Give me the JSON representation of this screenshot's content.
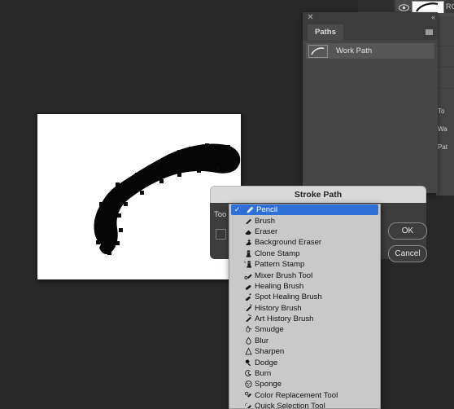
{
  "app": {
    "background_color": "#282828"
  },
  "channels_strip": {
    "eye_icon": "eye-icon",
    "thumbnail_icon": "path-thumbnail-icon",
    "label": "RGB"
  },
  "background_panel": {
    "lines": [
      "To",
      "Wa",
      "Pat"
    ]
  },
  "paths_panel": {
    "close_icon": "close-icon",
    "collapse_icon": "collapse-double-chevron-icon",
    "tab_label": "Paths",
    "menu_icon": "panel-menu-icon",
    "rows": [
      {
        "label": "Work Path",
        "thumbnail_icon": "path-thumbnail-icon"
      }
    ]
  },
  "document": {
    "canvas_background": "#ffffff",
    "artwork_color": "#000000",
    "artwork_name": "brush-stroke-path-shape"
  },
  "stroke_dialog": {
    "title": "Stroke Path",
    "tool_label": "Too",
    "checkbox_checked": false,
    "ok_label": "OK",
    "cancel_label": "Cancel",
    "accent_color": "#2f6fd8"
  },
  "tool_dropdown": {
    "selected": "Pencil",
    "check_glyph": "✓",
    "items": [
      {
        "label": "Pencil",
        "icon": "pencil-icon",
        "selected": true
      },
      {
        "label": "Brush",
        "icon": "brush-icon",
        "selected": false
      },
      {
        "label": "Eraser",
        "icon": "eraser-icon",
        "selected": false
      },
      {
        "label": "Background Eraser",
        "icon": "background-eraser-icon",
        "selected": false
      },
      {
        "label": "Clone Stamp",
        "icon": "clone-stamp-icon",
        "selected": false
      },
      {
        "label": "Pattern Stamp",
        "icon": "pattern-stamp-icon",
        "selected": false
      },
      {
        "label": "Mixer Brush Tool",
        "icon": "mixer-brush-icon",
        "selected": false
      },
      {
        "label": "Healing Brush",
        "icon": "healing-brush-icon",
        "selected": false
      },
      {
        "label": "Spot Healing Brush",
        "icon": "spot-healing-brush-icon",
        "selected": false
      },
      {
        "label": "History Brush",
        "icon": "history-brush-icon",
        "selected": false
      },
      {
        "label": "Art History Brush",
        "icon": "art-history-brush-icon",
        "selected": false
      },
      {
        "label": "Smudge",
        "icon": "smudge-icon",
        "selected": false
      },
      {
        "label": "Blur",
        "icon": "blur-icon",
        "selected": false
      },
      {
        "label": "Sharpen",
        "icon": "sharpen-icon",
        "selected": false
      },
      {
        "label": "Dodge",
        "icon": "dodge-icon",
        "selected": false
      },
      {
        "label": "Burn",
        "icon": "burn-icon",
        "selected": false
      },
      {
        "label": "Sponge",
        "icon": "sponge-icon",
        "selected": false
      },
      {
        "label": "Color Replacement Tool",
        "icon": "color-replacement-icon",
        "selected": false
      },
      {
        "label": "Quick Selection Tool",
        "icon": "quick-selection-icon",
        "selected": false
      }
    ]
  }
}
